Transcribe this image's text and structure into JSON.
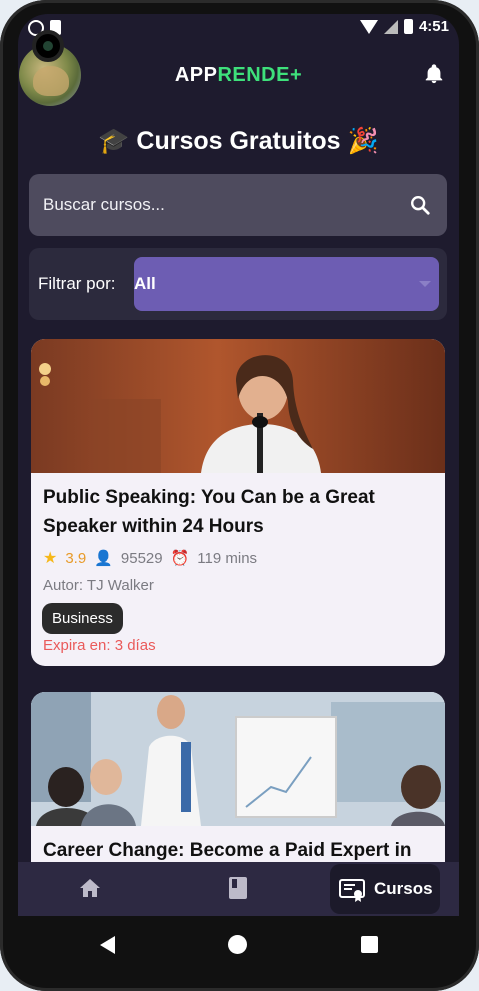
{
  "status_bar": {
    "time": "4:51"
  },
  "header": {
    "brand_part1": "APP",
    "brand_part2": "RENDE+",
    "bell_icon": "bell-icon"
  },
  "page_title": "🎓 Cursos Gratuitos 🎉",
  "search": {
    "placeholder": "Buscar cursos..."
  },
  "filter": {
    "label": "Filtrar por:",
    "selected": "All"
  },
  "courses": [
    {
      "title": "Public Speaking: You Can be a Great Speaker within 24 Hours",
      "rating": "3.9",
      "students": "95529",
      "duration": "119 mins",
      "author": "Autor: TJ Walker",
      "category": "Business",
      "expires": "Expira en: 3 días"
    },
    {
      "title": "Career Change: Become a Paid Expert in"
    }
  ],
  "bottom_nav": {
    "items": [
      {
        "icon": "home-icon"
      },
      {
        "icon": "book-icon"
      },
      {
        "icon": "certificate-icon",
        "label": "Cursos",
        "active": true
      }
    ]
  },
  "colors": {
    "background": "#1e1b2e",
    "brand_green": "#3ee07b",
    "filter_accent": "#6d5db3",
    "expire_red": "#ea5a5a"
  }
}
